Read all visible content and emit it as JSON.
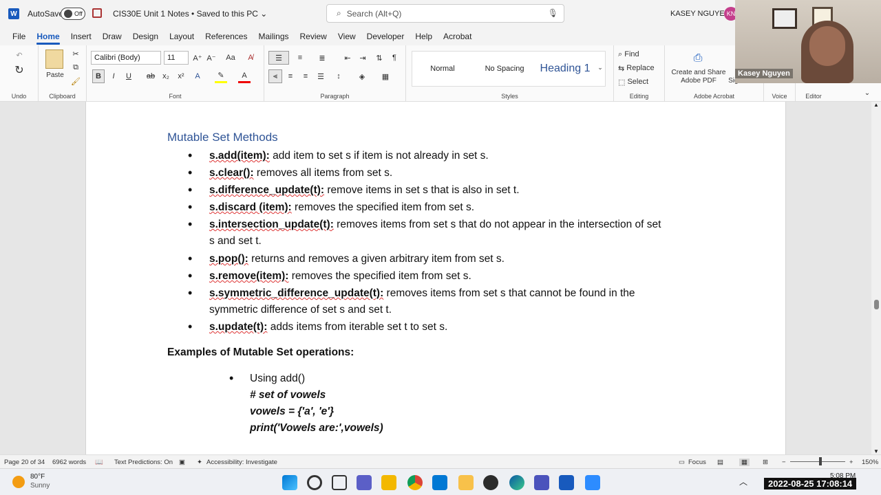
{
  "titlebar": {
    "autosave_label": "AutoSave",
    "toggle_state": "Off",
    "doc_title": "CIS30E Unit 1 Notes • Saved to this PC",
    "search_placeholder": "Search (Alt+Q)",
    "user_name": "KASEY NGUYEN",
    "user_initials": "KN"
  },
  "tabs": [
    "File",
    "Home",
    "Insert",
    "Draw",
    "Design",
    "Layout",
    "References",
    "Mailings",
    "Review",
    "View",
    "Developer",
    "Help",
    "Acrobat"
  ],
  "ribbon": {
    "undo_label": "Undo",
    "clipboard_label": "Clipboard",
    "paste_label": "Paste",
    "font_name": "Calibri (Body)",
    "font_size": "11",
    "font_label": "Font",
    "paragraph_label": "Paragraph",
    "styles": [
      "Normal",
      "No Spacing",
      "Heading 1"
    ],
    "styles_label": "Styles",
    "find_label": "Find",
    "replace_label": "Replace",
    "select_label": "Select",
    "editing_label": "Editing",
    "adobe_button": "Create and Share Adobe PDF",
    "adobe_label": "Adobe Acrobat",
    "voice_label": "Voice",
    "editor_label": "Editor",
    "truncated_button": "R Signatures"
  },
  "document": {
    "heading": "Mutable Set Methods",
    "methods": [
      {
        "name": "s.add(item):",
        "desc": " add item to set s if item is not already in set s."
      },
      {
        "name": "s.clear():",
        "desc": " removes all items from set s."
      },
      {
        "name": "s.difference_update(t):",
        "desc": " remove items in set s that is also in set t."
      },
      {
        "name": "s.discard (item):",
        "desc": " removes the specified item from set s."
      },
      {
        "name": "s.intersection_update(t):",
        "desc": " removes items from set s that do not appear in the intersection of set",
        "desc2": "s and set t."
      },
      {
        "name": "s.pop():",
        "desc": " returns and removes a given arbitrary item from set s."
      },
      {
        "name": "s.remove(item):",
        "desc": " removes the specified item from set s."
      },
      {
        "name": "s.symmetric_difference_update(t):",
        "desc": " removes items from set s that cannot be found in the",
        "desc2": "symmetric difference of set s and set t."
      },
      {
        "name": "s.update(t):",
        "desc": " adds items from iterable set t to set s."
      }
    ],
    "examples_heading": "Examples of Mutable Set operations:",
    "example_bullet": "Using add()",
    "code_lines": [
      "# set of vowels",
      "vowels = {'a', 'e'}",
      "print('Vowels are:',vowels)"
    ]
  },
  "statusbar": {
    "page": "Page 20 of 34",
    "words": "6962 words",
    "text_predictions": "Text Predictions: On",
    "accessibility": "Accessibility: Investigate",
    "focus": "Focus",
    "zoom": "150%"
  },
  "taskbar": {
    "weather_temp": "80°F",
    "weather_desc": "Sunny",
    "time": "5:08 PM",
    "timestamp": "2022-08-25  17:08:14"
  },
  "webcam": {
    "name_label": "Kasey Nguyen"
  }
}
